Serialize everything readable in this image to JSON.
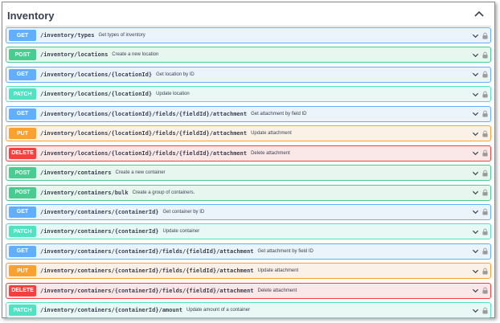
{
  "section": {
    "title": "Inventory"
  },
  "operations": [
    {
      "method": "GET",
      "path": "/inventory/types",
      "summary": "Get types of inventory"
    },
    {
      "method": "POST",
      "path": "/inventory/locations",
      "summary": "Create a new location"
    },
    {
      "method": "GET",
      "path": "/inventory/locations/{locationId}",
      "summary": "Get location by ID"
    },
    {
      "method": "PATCH",
      "path": "/inventory/locations/{locationId}",
      "summary": "Update location"
    },
    {
      "method": "GET",
      "path": "/inventory/locations/{locationId}/fields/{fieldId}/attachment",
      "summary": "Get attachment by field ID"
    },
    {
      "method": "PUT",
      "path": "/inventory/locations/{locationId}/fields/{fieldId}/attachment",
      "summary": "Update attachment"
    },
    {
      "method": "DELETE",
      "path": "/inventory/locations/{locationId}/fields/{fieldId}/attachment",
      "summary": "Delete attachment"
    },
    {
      "method": "POST",
      "path": "/inventory/containers",
      "summary": "Create a new container"
    },
    {
      "method": "POST",
      "path": "/inventory/containers/bulk",
      "summary": "Create a group of containers."
    },
    {
      "method": "GET",
      "path": "/inventory/containers/{containerId}",
      "summary": "Get container by ID"
    },
    {
      "method": "PATCH",
      "path": "/inventory/containers/{containerId}",
      "summary": "Update container"
    },
    {
      "method": "GET",
      "path": "/inventory/containers/{containerId}/fields/{fieldId}/attachment",
      "summary": "Get attachment by field ID"
    },
    {
      "method": "PUT",
      "path": "/inventory/containers/{containerId}/fields/{fieldId}/attachment",
      "summary": "Update attachment"
    },
    {
      "method": "DELETE",
      "path": "/inventory/containers/{containerId}/fields/{fieldId}/attachment",
      "summary": "Delete attachment"
    },
    {
      "method": "PATCH",
      "path": "/inventory/containers/{containerId}/amount",
      "summary": "Update amount of a container"
    }
  ],
  "icons": {
    "collapse": "chevron-up-icon",
    "expand": "chevron-down-icon",
    "auth": "lock-icon"
  },
  "colors": {
    "GET": "#61affe",
    "POST": "#49cc90",
    "PATCH": "#50e3c2",
    "PUT": "#fca130",
    "DELETE": "#f93e3e",
    "text": "#3b4151"
  }
}
